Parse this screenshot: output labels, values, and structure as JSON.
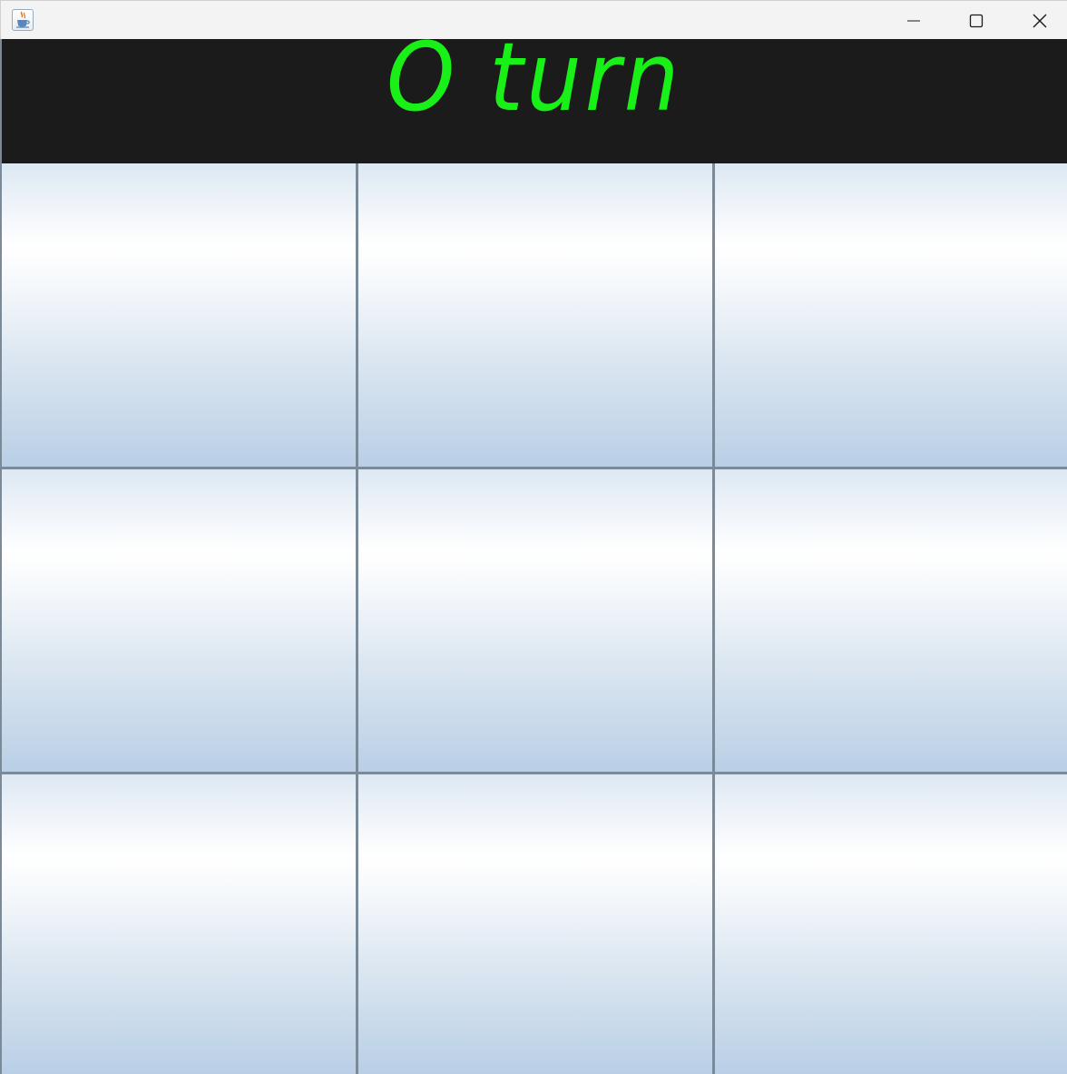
{
  "window": {
    "title": "",
    "app_icon": "java-cup-icon",
    "controls": [
      {
        "name": "minimize-button",
        "icon": "minimize-icon"
      },
      {
        "name": "maximize-button",
        "icon": "maximize-icon"
      },
      {
        "name": "close-button",
        "icon": "close-icon"
      }
    ]
  },
  "header": {
    "status_text": "O turn",
    "text_color": "#18f018",
    "background": "#1b1b1b"
  },
  "board": {
    "cells": [
      "",
      "",
      "",
      "",
      "",
      "",
      "",
      "",
      ""
    ],
    "grid_color": "#7a8a99"
  }
}
